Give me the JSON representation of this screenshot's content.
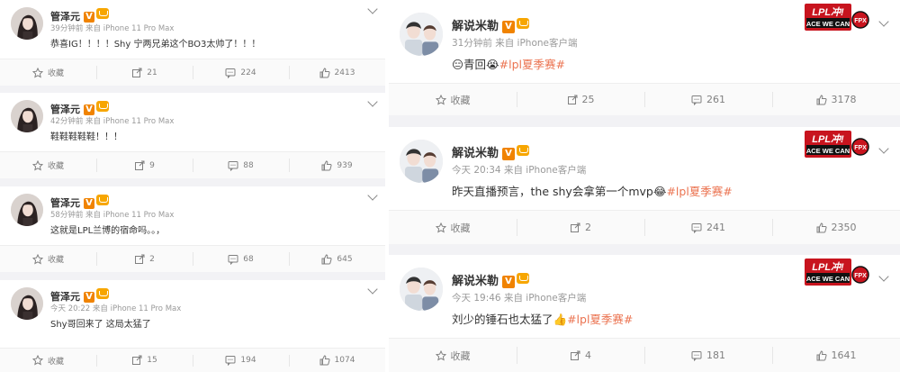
{
  "left_posts": [
    {
      "name": "管泽元",
      "time": "39分钟前",
      "source": "来自 iPhone 11 Pro Max",
      "text": "恭喜IG！！！！Shy 宁两兄弟这个BO3太帅了！！！",
      "actions": {
        "collect": "收藏",
        "share": "21",
        "comment": "224",
        "like": "2413"
      }
    },
    {
      "name": "管泽元",
      "time": "42分钟前",
      "source": "来自 iPhone 11 Pro Max",
      "text": "鞋鞋鞋鞋鞋！！！",
      "actions": {
        "collect": "收藏",
        "share": "9",
        "comment": "88",
        "like": "939"
      }
    },
    {
      "name": "管泽元",
      "time": "58分钟前",
      "source": "来自 iPhone 11 Pro Max",
      "text": "这就是LPL兰博的宿命吗。。，",
      "actions": {
        "collect": "收藏",
        "share": "2",
        "comment": "68",
        "like": "645"
      }
    },
    {
      "name": "管泽元",
      "time": "今天 20:22",
      "source": "来自 iPhone 11 Pro Max",
      "text": "Shy哥回来了 这局太猛了",
      "actions": {
        "collect": "收藏",
        "share": "15",
        "comment": "194",
        "like": "1074"
      }
    }
  ],
  "right_posts": [
    {
      "name": "解说米勒",
      "time": "31分钟前",
      "source": "来自 iPhone客户端",
      "text": "😑青回😭",
      "hashtag": "#lpl夏季赛#",
      "badge_text": "LPL冲! ACE WE CAN",
      "actions": {
        "collect": "收藏",
        "share": "25",
        "comment": "261",
        "like": "3178"
      }
    },
    {
      "name": "解说米勒",
      "time": "今天 20:34",
      "source": "来自 iPhone客户端",
      "text": "昨天直播预言，the shy会拿第一个mvp😂",
      "hashtag": "#lpl夏季赛#",
      "badge_text": "LPL冲! ACE WE CAN",
      "actions": {
        "collect": "收藏",
        "share": "2",
        "comment": "241",
        "like": "2350"
      }
    },
    {
      "name": "解说米勒",
      "time": "今天 19:46",
      "source": "来自 iPhone客户端",
      "text": "刘少的锤石也太猛了👍",
      "hashtag": "#lpl夏季赛#",
      "badge_text": "LPL冲! ACE WE CAN",
      "actions": {
        "collect": "收藏",
        "share": "4",
        "comment": "181",
        "like": "1641"
      }
    }
  ],
  "colors": {
    "tag": "#eb7350",
    "meta": "#999999",
    "action": "#808080",
    "vip": "#f08300"
  },
  "icons": [
    "star-icon",
    "share-icon",
    "comment-icon",
    "like-icon",
    "chevron-down-icon",
    "verified-icon",
    "vip-crown-icon"
  ]
}
